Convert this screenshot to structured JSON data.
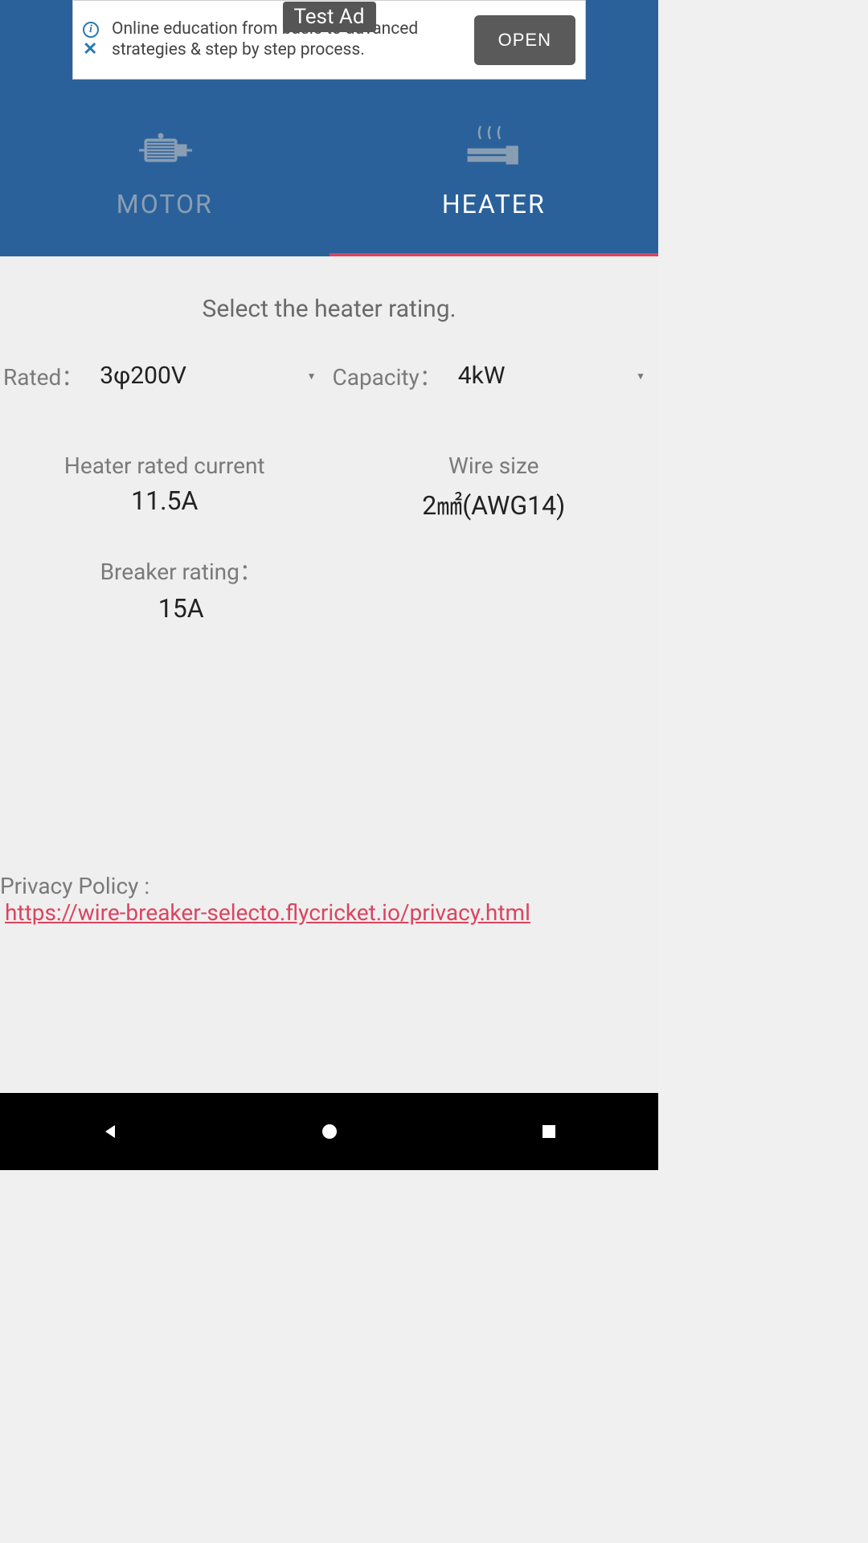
{
  "ad": {
    "label": "Test Ad",
    "text": "Online education from basic to advanced strategies & step by step process.",
    "button": "OPEN"
  },
  "tabs": {
    "motor": "MOTOR",
    "heater": "HEATER"
  },
  "content": {
    "heading": "Select the heater rating.",
    "rated_label": "Rated：",
    "rated_value": "3φ200V",
    "capacity_label": "Capacity：",
    "capacity_value": "4kW"
  },
  "results": {
    "current_label": "Heater rated current",
    "current_value": "11.5A",
    "wire_label": "Wire size",
    "wire_value": "2㎟(AWG14)",
    "breaker_label": "Breaker rating：",
    "breaker_value": "15A"
  },
  "privacy": {
    "label": "Privacy Policy :",
    "url": "https://wire-breaker-selecto.flycricket.io/privacy.html"
  }
}
